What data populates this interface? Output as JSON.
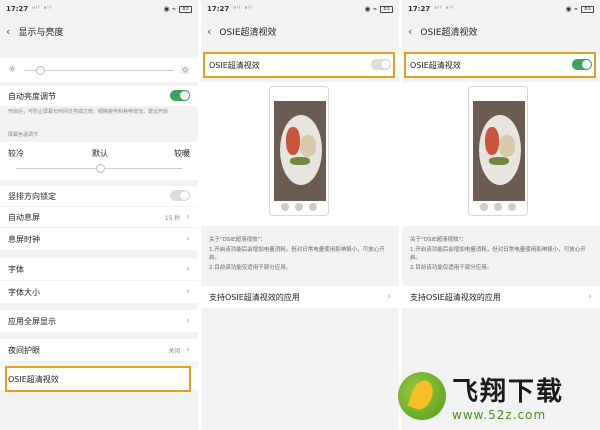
{
  "status_time": "17:27",
  "status_signal": "ᵃˡˡ ᵃˡˡ",
  "status_icons": "◉ ⌁",
  "battery": "83",
  "panel1": {
    "title": "显示与亮度",
    "auto_brightness": "自动亮度调节",
    "auto_brightness_note": "开启后，可防止屏幕长时间过亮或过暗，眼睛疲劳和耗电增加，建议开启",
    "color_temp_header": "屏幕色温调节",
    "temp_cool": "较冷",
    "temp_default": "默认",
    "temp_warm": "较暖",
    "rotation_lock": "竖排方向锁定",
    "auto_sleep": "自动息屏",
    "auto_sleep_value": "15 秒",
    "screen_clock": "息屏时钟",
    "font": "字体",
    "font_size": "字体大小",
    "fullscreen_apps": "应用全屏显示",
    "night_mode": "夜间护眼",
    "night_mode_value": "关闭",
    "osie": "OSIE超清视效"
  },
  "panel2": {
    "title": "OSIE超清视效",
    "toggle_label": "OSIE超清视效",
    "toggle_state": "off",
    "about_title": "关于\"OSIE超清视效\"：",
    "about_1": "1.开启该功能后会增加电量消耗，但对日常电量使用影响极小，可放心开启。",
    "about_2": "2.目前该功能仅适用于部分应用。",
    "supported_apps": "支持OSIE超清视效的应用"
  },
  "panel3": {
    "title": "OSIE超清视效",
    "toggle_label": "OSIE超清视效",
    "toggle_state": "on",
    "about_title": "关于\"OSIE超清视效\"：",
    "about_1": "1.开启该功能后会增加电量消耗，但对日常电量使用影响极小，可放心开启。",
    "about_2": "2.目前该功能仅适用于部分应用。",
    "supported_apps": "支持OSIE超清视效的应用"
  },
  "watermark": {
    "title": "飞翔下载",
    "url": "www.52z.com"
  },
  "colors": {
    "highlight": "#e0a020",
    "toggle_on": "#3aa35c"
  }
}
